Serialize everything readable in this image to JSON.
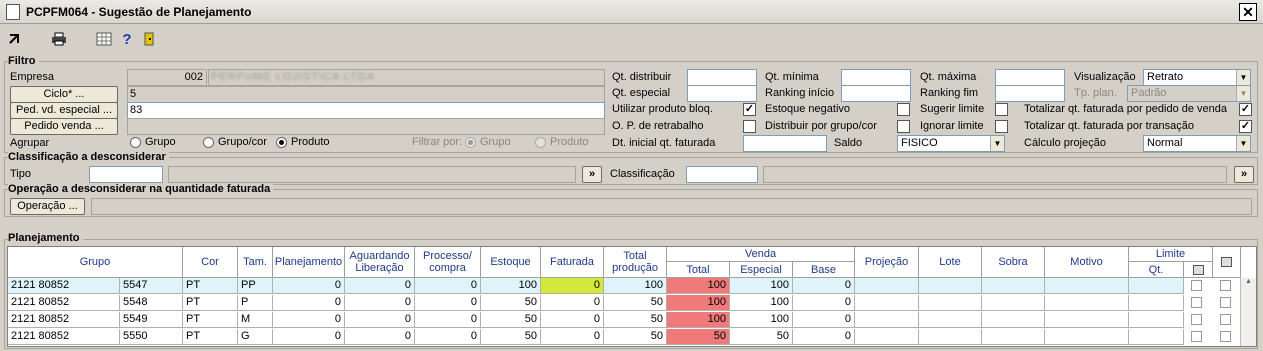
{
  "window": {
    "title": "PCPFM064 - Sugestão de Planejamento",
    "close": "✕"
  },
  "toolbar": {
    "icons": [
      "exit-icon",
      "printer-icon",
      "calculator-icon",
      "help-icon",
      "door-icon"
    ],
    "help": "?"
  },
  "filtro": {
    "title": "Filtro",
    "empresa_label": "Empresa",
    "empresa_code": "002",
    "empresa_name": "PERFUME LOJISTICA LTDA",
    "ciclo_btn": "Ciclo* ...",
    "ciclo_value": "5",
    "ped_btn": "Ped. vd. especial ...",
    "ped_value": "83",
    "pedido_btn": "Pedido venda ...",
    "agrupar_label": "Agrupar",
    "agrupar_opts": [
      "Grupo",
      "Grupo/cor",
      "Produto"
    ],
    "filtrar_label": "Filtrar por:",
    "filtrar_opts": [
      "Grupo",
      "Produto"
    ],
    "qt_distribuir": "Qt. distribuir",
    "qt_especial": "Qt. especial",
    "utilizar": "Utilizar produto bloq.",
    "op_retrabalho": "O. P. de retrabalho",
    "dt_inicial": "Dt. inicial qt. faturada",
    "qt_minima": "Qt. mínima",
    "ranking_inicio": "Ranking início",
    "estoque_negativo": "Estoque negativo",
    "distribuir_grupo": "Distribuir por grupo/cor",
    "saldo": "Saldo",
    "saldo_value": "FISICO",
    "qt_maxima": "Qt. máxima",
    "ranking_fim": "Ranking fim",
    "sugerir_limite": "Sugerir limite",
    "ignorar_limite": "Ignorar limite",
    "visualizacao": "Visualização",
    "visualizacao_value": "Retrato",
    "tp_plan": "Tp. plan.",
    "tp_plan_value": "Padrão",
    "totalizar_pedido": "Totalizar qt. faturada por pedido de venda",
    "totalizar_transacao": "Totalizar qt. faturada por transação",
    "calculo": "Cálculo projeção",
    "calculo_value": "Normal"
  },
  "classificacao": {
    "title": "Classificação a desconsiderar",
    "tipo": "Tipo",
    "classificacao": "Classificação",
    "more": "»"
  },
  "operacao": {
    "title": "Operação a desconsiderar na quantidade faturada",
    "btn": "Operação ..."
  },
  "planejamento": {
    "title": "Planejamento",
    "headers": {
      "grupo": "Grupo",
      "cor": "Cor",
      "tam": "Tam.",
      "planejamento": "Planejamento",
      "aguardando": "Aguardando Liberação",
      "processo": "Processo/ compra",
      "estoque": "Estoque",
      "faturada": "Faturada",
      "total_producao": "Total produção",
      "venda": "Venda",
      "total": "Total",
      "especial": "Especial",
      "base": "Base",
      "projecao": "Projeção",
      "lote": "Lote",
      "sobra": "Sobra",
      "motivo": "Motivo",
      "limite": "Limite",
      "qt": "Qt."
    },
    "rows": [
      {
        "grupo": "2121 80852",
        "sub": "5547",
        "cor": "PT",
        "tam": "PP",
        "plan": "0",
        "aguard": "0",
        "proc": "0",
        "estoque": "100",
        "fat": "0",
        "totprod": "100",
        "total": "100",
        "especial": "100",
        "base": "0"
      },
      {
        "grupo": "2121 80852",
        "sub": "5548",
        "cor": "PT",
        "tam": "P",
        "plan": "0",
        "aguard": "0",
        "proc": "0",
        "estoque": "50",
        "fat": "0",
        "totprod": "50",
        "total": "100",
        "especial": "100",
        "base": "0"
      },
      {
        "grupo": "2121 80852",
        "sub": "5549",
        "cor": "PT",
        "tam": "M",
        "plan": "0",
        "aguard": "0",
        "proc": "0",
        "estoque": "50",
        "fat": "0",
        "totprod": "50",
        "total": "100",
        "especial": "100",
        "base": "0"
      },
      {
        "grupo": "2121 80852",
        "sub": "5550",
        "cor": "PT",
        "tam": "G",
        "plan": "0",
        "aguard": "0",
        "proc": "0",
        "estoque": "50",
        "fat": "0",
        "totprod": "50",
        "total": "50",
        "especial": "50",
        "base": "0"
      }
    ]
  },
  "colors": {
    "selected_row": "#dff3fb",
    "faturada_selected": "#d4e83a",
    "total_red": "#f07a7a",
    "header_text": "#1f3a8a"
  }
}
